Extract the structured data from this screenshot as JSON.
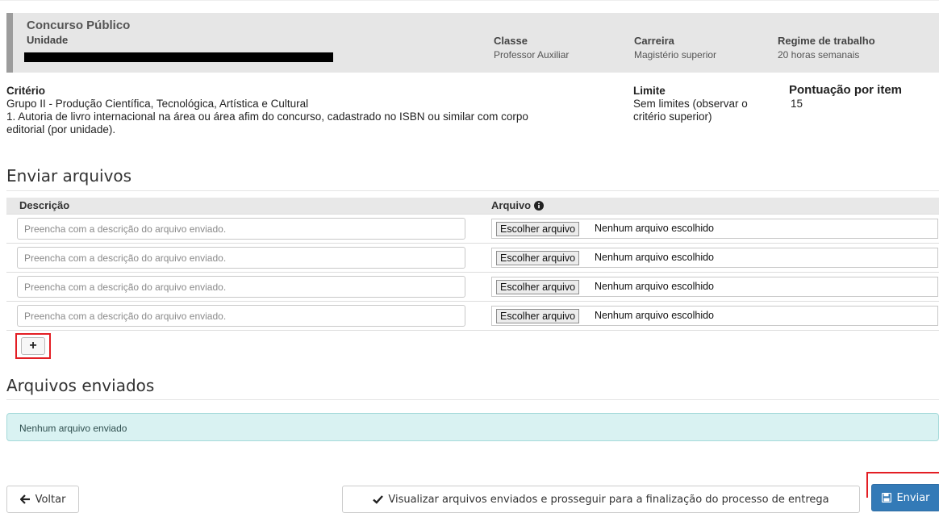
{
  "info": {
    "title": "Concurso Público",
    "unidade_label": "Unidade",
    "classe_label": "Classe",
    "classe_value": "Professor Auxiliar",
    "carreira_label": "Carreira",
    "carreira_value": "Magistério superior",
    "regime_label": "Regime de trabalho",
    "regime_value": "20 horas semanais"
  },
  "criterio": {
    "label": "Critério",
    "group": "Grupo II - Produção Científica, Tecnológica, Artística e Cultural",
    "desc_line1": "1. Autoria de livro internacional na área ou área afim do concurso, cadastrado no ISBN ou similar com corpo",
    "desc_line2": "editorial (por unidade).",
    "limite_label": "Limite",
    "limite_line1": "Sem limites (observar o",
    "limite_line2": "critério superior)",
    "pontuacao_label": "Pontuação por item",
    "pontuacao_value": "15"
  },
  "upload": {
    "heading": "Enviar arquivos",
    "col_descricao": "Descrição",
    "col_arquivo": "Arquivo",
    "info_icon": "info-circle-icon",
    "placeholder": "Preencha com a descrição do arquivo enviado.",
    "choose_label": "Escolher arquivo",
    "no_file": "Nenhum arquivo escolhido",
    "add_label": "+"
  },
  "sent": {
    "heading": "Arquivos enviados",
    "empty_msg": "Nenhum arquivo enviado"
  },
  "footer": {
    "back_label": "Voltar",
    "back_icon": "arrow-left-icon",
    "view_label": "Visualizar arquivos enviados e prosseguir para a finalização do processo de entrega",
    "view_icon": "checkmark-icon",
    "send_label": "Enviar",
    "send_icon": "floppy-disk-icon"
  },
  "colors": {
    "primary": "#337ab7",
    "highlight": "#e31e24",
    "alert_bg": "#d9f2f2"
  }
}
